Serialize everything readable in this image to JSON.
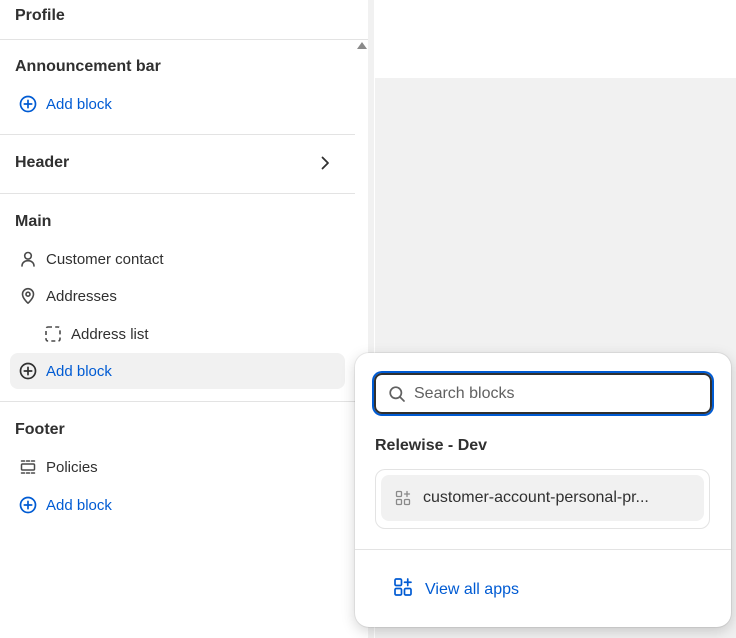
{
  "sidebar": {
    "title": "Profile",
    "announcement": {
      "heading": "Announcement bar",
      "add_block": "Add block"
    },
    "header": {
      "heading": "Header"
    },
    "main": {
      "heading": "Main",
      "items": [
        {
          "label": "Customer contact",
          "icon": "person-icon"
        },
        {
          "label": "Addresses",
          "icon": "location-pin-icon"
        },
        {
          "label": "Address list",
          "icon": "dashed-square-icon"
        }
      ],
      "add_block": "Add block"
    },
    "footer": {
      "heading": "Footer",
      "items": [
        {
          "label": "Policies",
          "icon": "layout-section-icon"
        }
      ],
      "add_block": "Add block"
    }
  },
  "popover": {
    "search_placeholder": "Search blocks",
    "search_value": "",
    "group_title": "Relewise - Dev",
    "block_item": "customer-account-personal-pr...",
    "view_all_apps": "View all apps"
  },
  "colors": {
    "link": "#005bd3",
    "text": "#303030",
    "hover_bg": "#f1f1f1",
    "border": "#e3e3e3"
  }
}
